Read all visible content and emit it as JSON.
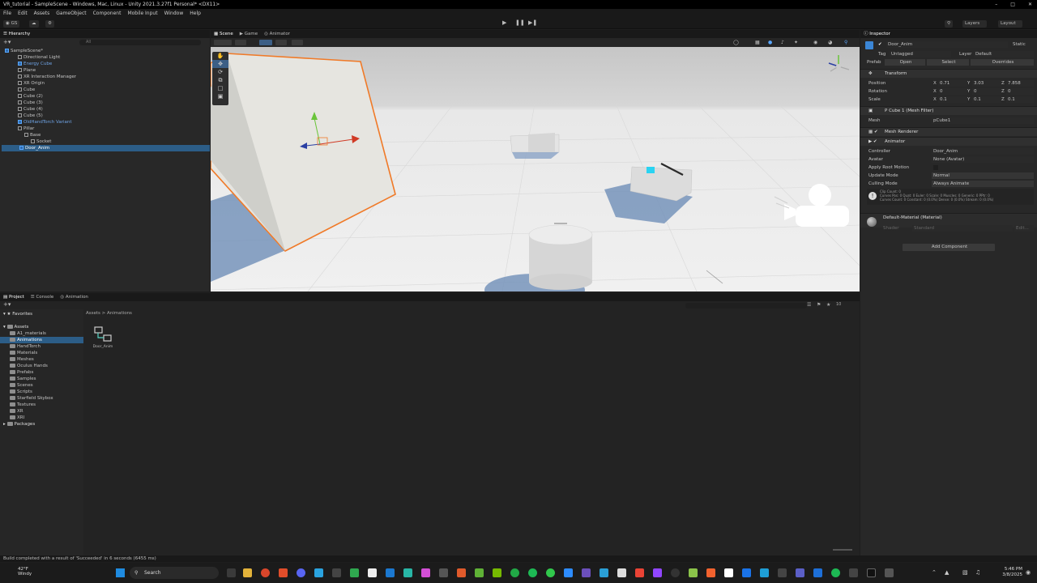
{
  "window": {
    "title": "VR_tutorial - SampleScene - Windows, Mac, Linux - Unity 2021.3.27f1 Personal* <DX11>"
  },
  "menu": [
    "File",
    "Edit",
    "Assets",
    "GameObject",
    "Component",
    "Mobile Input",
    "Window",
    "Help"
  ],
  "toolbar": {
    "account": "GS",
    "layers": "Layers",
    "layout": "Layout"
  },
  "hierarchy": {
    "tab": "Hierarchy",
    "search_placeholder": "All",
    "items": [
      {
        "label": "SampleScene*",
        "indent": 0,
        "kind": "scene"
      },
      {
        "label": "Directional Light",
        "indent": 2,
        "kind": "obj"
      },
      {
        "label": "Energy Cube",
        "indent": 2,
        "kind": "prefab"
      },
      {
        "label": "Plane",
        "indent": 2,
        "kind": "obj"
      },
      {
        "label": "XR Interaction Manager",
        "indent": 2,
        "kind": "obj"
      },
      {
        "label": "XR Origin",
        "indent": 2,
        "kind": "obj"
      },
      {
        "label": "Cube",
        "indent": 2,
        "kind": "obj"
      },
      {
        "label": "Cube (2)",
        "indent": 2,
        "kind": "obj"
      },
      {
        "label": "Cube (3)",
        "indent": 2,
        "kind": "obj"
      },
      {
        "label": "Cube (4)",
        "indent": 2,
        "kind": "obj"
      },
      {
        "label": "Cube (5)",
        "indent": 2,
        "kind": "obj"
      },
      {
        "label": "OldHandTorch Variant",
        "indent": 2,
        "kind": "prefab"
      },
      {
        "label": "Pillar",
        "indent": 2,
        "kind": "obj"
      },
      {
        "label": "Base",
        "indent": 3,
        "kind": "obj"
      },
      {
        "label": "Socket",
        "indent": 4,
        "kind": "obj"
      },
      {
        "label": "Door_Anim",
        "indent": 2,
        "kind": "selected"
      }
    ]
  },
  "scene": {
    "tabs": [
      "Scene",
      "Game",
      "Animator"
    ],
    "active_tab": "Scene"
  },
  "inspector": {
    "tab": "Inspector",
    "object_name": "Door_Anim",
    "static_label": "Static",
    "tag_label": "Tag",
    "tag_value": "Untagged",
    "layer_label": "Layer",
    "layer_value": "Default",
    "prefab_label": "Prefab",
    "prefab_open": "Open",
    "prefab_select": "Select",
    "prefab_overrides": "Overrides",
    "transform": {
      "title": "Transform",
      "position_label": "Position",
      "rotation_label": "Rotation",
      "scale_label": "Scale",
      "position": {
        "x": "0.71",
        "y": "3.03",
        "z": "7.858"
      },
      "rotation": {
        "x": "0",
        "y": "0",
        "z": "0"
      },
      "scale": {
        "x": "0.1",
        "y": "0.1",
        "z": "0.1"
      }
    },
    "mesh_filter": {
      "title": "P Cube 1 (Mesh Filter)",
      "mesh_label": "Mesh",
      "mesh_value": "pCube1"
    },
    "mesh_renderer": {
      "title": "Mesh Renderer"
    },
    "animator": {
      "title": "Animator",
      "controller_label": "Controller",
      "controller_value": "Door_Anim",
      "avatar_label": "Avatar",
      "avatar_value": "None (Avatar)",
      "root_motion_label": "Apply Root Motion",
      "update_mode_label": "Update Mode",
      "update_mode_value": "Normal",
      "culling_mode_label": "Culling Mode",
      "culling_mode_value": "Always Animate",
      "info_lines": [
        "Clip Count: 0",
        "Curves Pos: 0 Quat: 0 Euler: 0 Scale: 0 Muscles: 0 Generic: 0 PPtr: 0",
        "Curves Count: 0 Constant: 0 (0.0%) Dense: 0 (0.0%) Stream: 0 (0.0%)"
      ]
    },
    "material": {
      "title": "Default-Material (Material)",
      "shader_label": "Shader",
      "shader_value": "Standard",
      "edit_label": "Edit..."
    },
    "add_component": "Add Component"
  },
  "project": {
    "tabs": [
      "Project",
      "Console",
      "Animation"
    ],
    "favorites": "Favorites",
    "assets_root": "Assets",
    "folders": [
      "A1_materials",
      "Animations",
      "HandTorch",
      "Materials",
      "Meshes",
      "Oculus Hands",
      "Prefabs",
      "Samples",
      "Scenes",
      "Scripts",
      "Starfield Skybox",
      "Textures",
      "XR",
      "XRI"
    ],
    "selected_folder": "Animations",
    "packages": "Packages",
    "breadcrumb": [
      "Assets",
      "Animations"
    ],
    "asset_items": [
      "Door_Anim"
    ],
    "count_badge": "10"
  },
  "status": {
    "message": "Build completed with a result of 'Succeeded' in 6 seconds (6455 ms)"
  },
  "taskbar": {
    "weather_temp": "42°F",
    "weather_desc": "Windy",
    "search_label": "Search",
    "time": "5:46 PM",
    "date": "3/8/2025"
  },
  "colors": {
    "selection": "#2c5d87",
    "prefab_blue": "#6fa4e6",
    "highlight_orange": "#f07a28"
  }
}
